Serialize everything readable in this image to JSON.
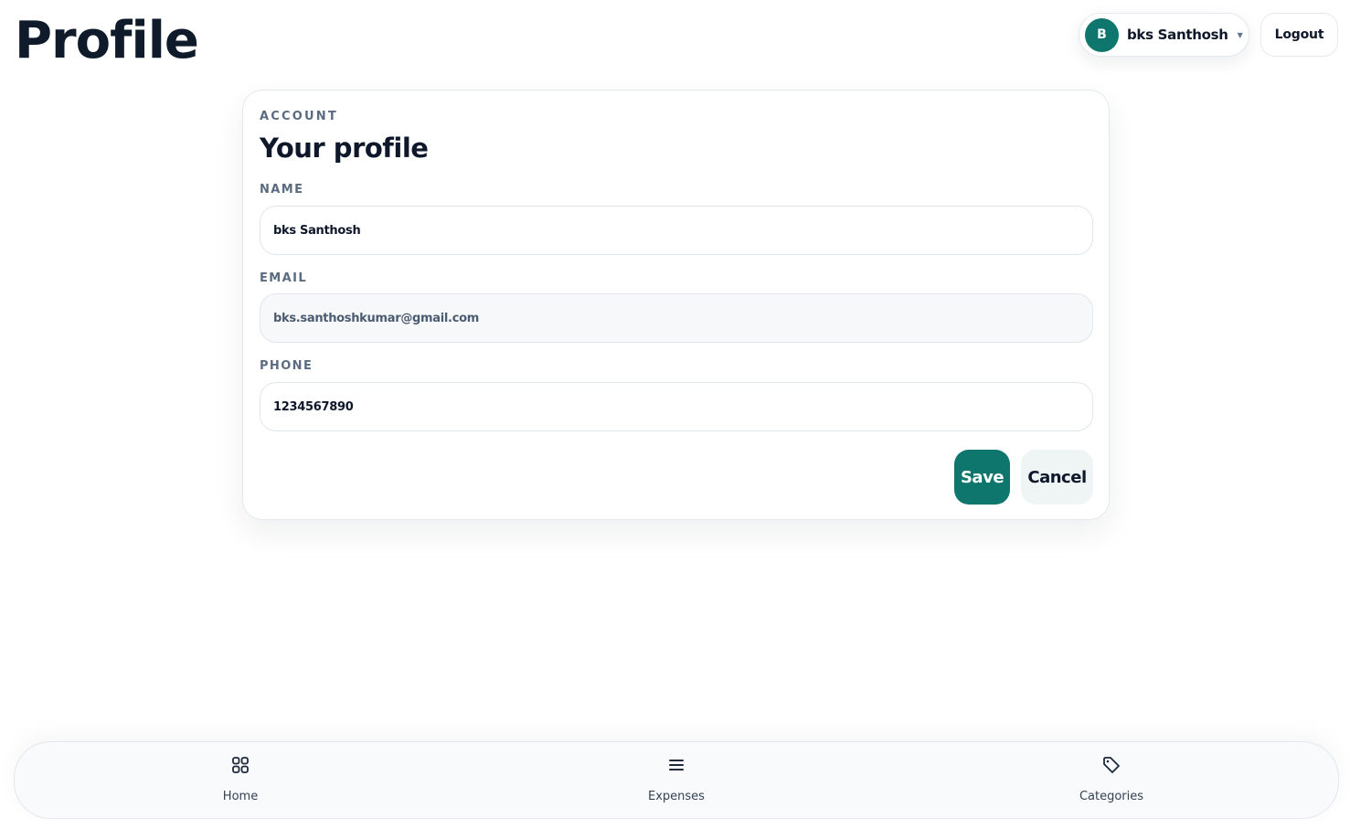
{
  "header": {
    "title": "Profile",
    "user": {
      "initial": "B",
      "name": "bks Santhosh"
    },
    "logout_label": "Logout"
  },
  "card": {
    "eyebrow": "ACCOUNT",
    "title": "Your profile",
    "fields": {
      "name": {
        "label": "NAME",
        "value": "bks Santhosh"
      },
      "email": {
        "label": "EMAIL",
        "value": "bks.santhoshkumar@gmail.com"
      },
      "phone": {
        "label": "PHONE",
        "value": "1234567890"
      }
    },
    "save_label": "Save",
    "cancel_label": "Cancel"
  },
  "nav": {
    "items": [
      {
        "label": "Home",
        "icon": "grid-icon"
      },
      {
        "label": "Expenses",
        "icon": "list-icon"
      },
      {
        "label": "Categories",
        "icon": "tag-icon"
      }
    ]
  },
  "colors": {
    "accent": "#0f766e",
    "text": "#0f172a",
    "muted": "#5b6b80"
  }
}
